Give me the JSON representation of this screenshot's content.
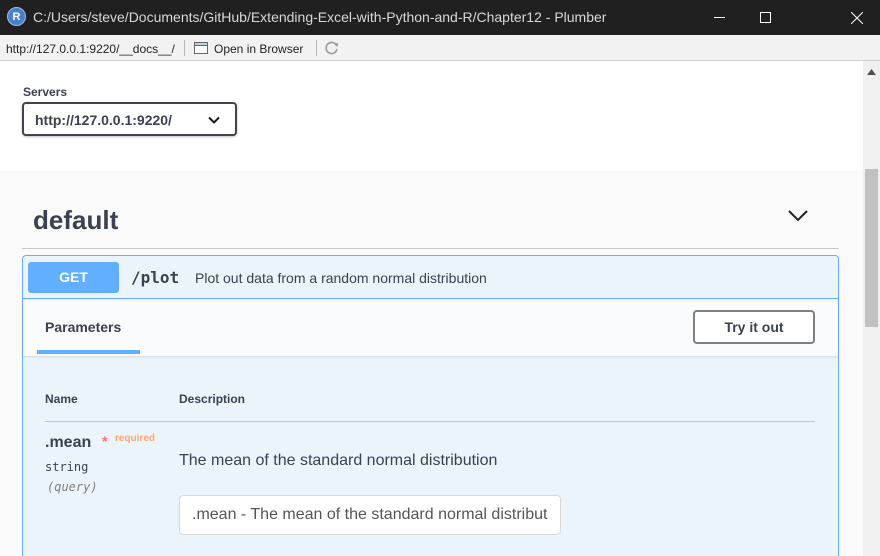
{
  "window": {
    "app_icon": "R",
    "title": "C:/Users/steve/Documents/GitHub/Extending-Excel-with-Python-and-R/Chapter12 - Plumber",
    "controls": [
      "minimize-icon",
      "maximize-icon",
      "close-icon"
    ]
  },
  "addressbar": {
    "url": "http://127.0.0.1:9220/__docs__/",
    "open_in_browser": "Open in Browser",
    "icons": [
      "open-in-browser-icon",
      "refresh-icon"
    ]
  },
  "servers": {
    "label": "Servers",
    "selected": "http://127.0.0.1:9220/"
  },
  "tag": {
    "title": "default"
  },
  "operation": {
    "method": "GET",
    "path": "/plot",
    "description": "Plot out data from a random normal distribution",
    "parameters_tab": "Parameters",
    "try_button": "Try it out",
    "columns": {
      "name": "Name",
      "description": "Description"
    },
    "params": [
      {
        "name": ".mean",
        "required_star": "*",
        "required_label": "required",
        "type": "string",
        "in": "(query)",
        "description": "The mean of the standard normal distribution",
        "placeholder": ".mean - The mean of the standard normal distribution"
      }
    ]
  },
  "colors": {
    "titlebar": "#202020",
    "get_method": "#61affe",
    "opblock_bg": "#ebf3fb",
    "required": "#ff6f6f",
    "text": "#3b4151"
  }
}
